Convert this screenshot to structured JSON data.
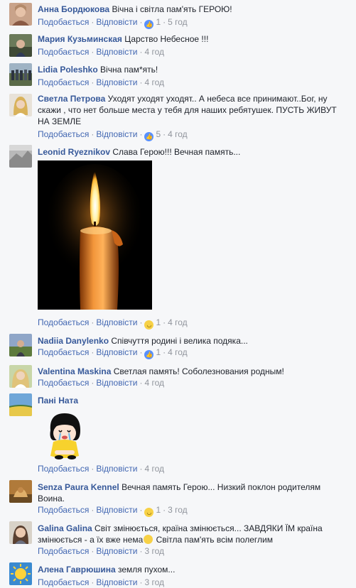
{
  "comments": [
    {
      "author": "Анна Бордюкова",
      "text": "Вічна і світла пам'ять ГЕРОЮ!",
      "like_label": "Подобається",
      "reply_label": "Відповісти",
      "reaction": "like-icon",
      "reaction_count": "1",
      "time": "5 год"
    },
    {
      "author": "Мария Кузьминская",
      "text": "Царство Небесное !!!",
      "like_label": "Подобається",
      "reply_label": "Відповісти",
      "time": "4 год"
    },
    {
      "author": "Lidia Poleshko",
      "text": "Вічна пам*ять!",
      "like_label": "Подобається",
      "reply_label": "Відповісти",
      "time": "4 год"
    },
    {
      "author": "Светла Петрова",
      "text": "Уходят уходят уходят.. А небеса все принимают..Бог, ну скажи , что нет больше места у тебя для наших ребятушек. ПУСТЬ ЖИВУТ НА ЗЕМЛЕ",
      "like_label": "Подобається",
      "reply_label": "Відповісти",
      "reaction": "like-icon",
      "reaction_count": "5",
      "time": "4 год"
    },
    {
      "author": "Leonid Ryeznikov",
      "text": "Слава Герою!!! Вечная память...",
      "like_label": "Подобається",
      "reply_label": "Відповісти",
      "reaction": "sad-icon",
      "reaction_count": "1",
      "time": "4 год"
    },
    {
      "author": "Nadiia Danylenko",
      "text": "Співчуття родині і велика подяка...",
      "like_label": "Подобається",
      "reply_label": "Відповісти",
      "reaction": "like-icon",
      "reaction_count": "1",
      "time": "4 год"
    },
    {
      "author": "Valentina Maskina",
      "text": "Светлая память! Соболезнования родным!",
      "like_label": "Подобається",
      "reply_label": "Відповісти",
      "time": "4 год"
    },
    {
      "author": "Пані Ната",
      "text": "",
      "like_label": "Подобається",
      "reply_label": "Відповісти",
      "time": "4 год"
    },
    {
      "author": "Senza Paura Kennel",
      "text": "Вечная память Герою... Низкий поклон родителям Воина.",
      "like_label": "Подобається",
      "reply_label": "Відповісти",
      "reaction": "sad-icon",
      "reaction_count": "1",
      "time": "3 год"
    },
    {
      "author": "Galina Galina",
      "text_before": "Світ змінюється, країна змінюється... ЗАВДЯКИ ЇМ країна змінюється - а їх вже нема",
      "text_after": " Світла пам'ять всім полеглим",
      "like_label": "Подобається",
      "reply_label": "Відповісти",
      "time": "3 год"
    },
    {
      "author": "Алена Гаврюшина",
      "text": "земля пухом...",
      "like_label": "Подобається",
      "reply_label": "Відповісти",
      "time": "3 год"
    }
  ],
  "colors": {
    "background": "#f6f7f9",
    "author_link": "#365899",
    "action_link": "#4267b2",
    "meta_gray": "#90949c",
    "like_blue": "#5890ff",
    "sad_yellow": "#f7d146"
  }
}
